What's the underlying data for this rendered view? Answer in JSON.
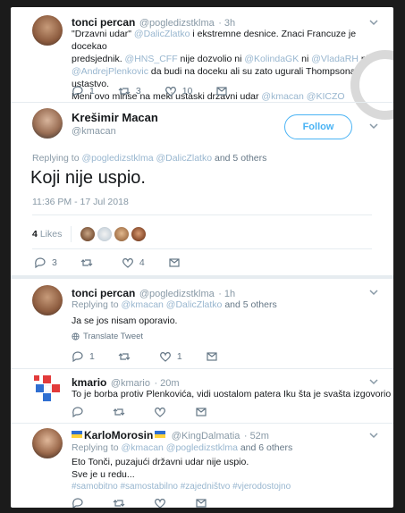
{
  "tweets": {
    "t1": {
      "name": "tonci percan",
      "handle": "@pogledizstklma",
      "time": "· 3h",
      "line1a": "\"Drzavni udar\"",
      "line1b": "@DalicZlatko",
      "line1c": "i ekstremne desnice. Znaci Francuze je docekao",
      "line2": "predsjednik.",
      "line2b": "@HNS_CFF",
      "line2c": "nije dozvolio ni",
      "line2d": "@KolindaGK",
      "line2e": "ni",
      "line2f": "@VladaRH",
      "line2g": "ni",
      "line3a": "@AndrejPlenkovic",
      "line3b": "da budi na doceku ali su zato ugurali Thompsona i ustastvo.",
      "line4a": "Meni ovo mirise na meki ustaski drzavni udar",
      "line4b": "@kmacan",
      "line4c": "@KICZO",
      "replies": "1",
      "retweets": "3",
      "likes": "10"
    },
    "main": {
      "name": "Krešimir Macan",
      "handle": "@kmacan",
      "follow_label": "Follow",
      "replying_to": "Replying to",
      "reply_handles": "@pogledizstklma @DalicZlatko",
      "reply_others": "and 5 others",
      "text": "Koji nije uspio.",
      "timestamp": "11:36 PM - 17 Jul 2018",
      "likes_count": "4",
      "likes_label": "Likes",
      "replies": "3",
      "retweets": "",
      "likes": "4"
    },
    "t3": {
      "name": "tonci percan",
      "handle": "@pogledizstklma",
      "time": "· 1h",
      "replying_to": "Replying to",
      "reply_handles": "@kmacan @DalicZlatko",
      "reply_others": "and 5 others",
      "text": "Ja se jos nisam oporavio.",
      "translate": "Translate Tweet",
      "replies": "1",
      "retweets": "",
      "likes": "1"
    },
    "t4": {
      "name": "kmario",
      "handle": "@kmario",
      "time": "· 20m",
      "text": "To je borba protiv Plenkovića, vidi uostalom patera Iku šta je svašta izgovorio",
      "replies": "",
      "retweets": "",
      "likes": ""
    },
    "t5": {
      "name": "KarloMorosin",
      "handle": "@KingDalmatia",
      "time": "· 52m",
      "replying_to": "Replying to",
      "reply_handles": "@kmacan @pogledizstklma",
      "reply_others": "and 6 others",
      "line1": "Eto Tonči, puzajući državni udar nije uspio.",
      "line2": "Sve je u redu...",
      "hashtags": "#samobitno #samostabilno #zajedništvo #vjerodostojno",
      "replies": "",
      "retweets": "",
      "likes": ""
    }
  },
  "colors": {
    "link": "#98b6cf",
    "follow_blue": "#4ab3f4",
    "muted": "#8899a6",
    "text": "#14171a",
    "divider": "#e6ecf0"
  }
}
